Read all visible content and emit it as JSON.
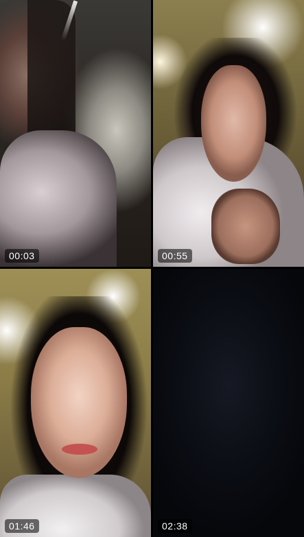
{
  "call": {
    "participants": [
      {
        "timer": "00:03",
        "frame": "dim restaurant interior"
      },
      {
        "timer": "00:55",
        "frame": "warm restaurant interior"
      },
      {
        "timer": "01:46",
        "frame": "bright restaurant interior"
      },
      {
        "timer": "02:38",
        "frame": "dark"
      }
    ]
  },
  "colors": {
    "background": "#000000",
    "timer_text": "#ffffff",
    "timer_badge": "rgba(0,0,0,0.55)"
  }
}
